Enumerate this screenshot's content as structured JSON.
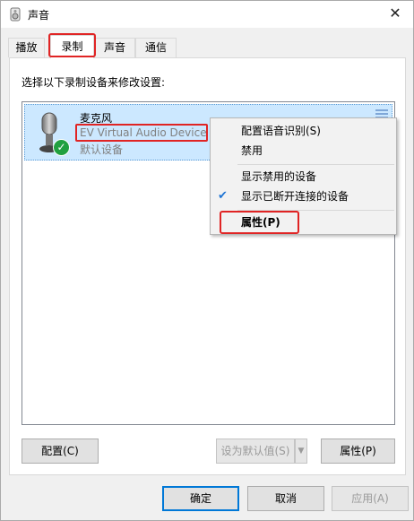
{
  "window": {
    "title": "声音",
    "close_glyph": "✕"
  },
  "tabs": [
    {
      "label": "播放",
      "active": false
    },
    {
      "label": "录制",
      "active": true
    },
    {
      "label": "声音",
      "active": false
    },
    {
      "label": "通信",
      "active": false
    }
  ],
  "panel": {
    "instruction": "选择以下录制设备来修改设置:"
  },
  "device": {
    "name": "麦克风",
    "description": "EV Virtual Audio Device",
    "status": "默认设备",
    "icon": "microphone-icon",
    "badge_icon": "checkmark-icon"
  },
  "context_menu": {
    "items": [
      {
        "label": "配置语音识别(S)"
      },
      {
        "label": "禁用"
      },
      {
        "label": "显示禁用的设备"
      },
      {
        "label": "显示已断开连接的设备",
        "checked": true
      },
      {
        "label": "属性(P)",
        "bold": true
      }
    ]
  },
  "panel_buttons": {
    "configure": "配置(C)",
    "set_default": "设为默认值(S)",
    "properties": "属性(P)"
  },
  "dialog_buttons": {
    "ok": "确定",
    "cancel": "取消",
    "apply": "应用(A)"
  },
  "colors": {
    "selection": "#cce8ff",
    "highlight_box": "#e02424",
    "check_badge": "#20a040",
    "default_button_border": "#0078d7"
  }
}
